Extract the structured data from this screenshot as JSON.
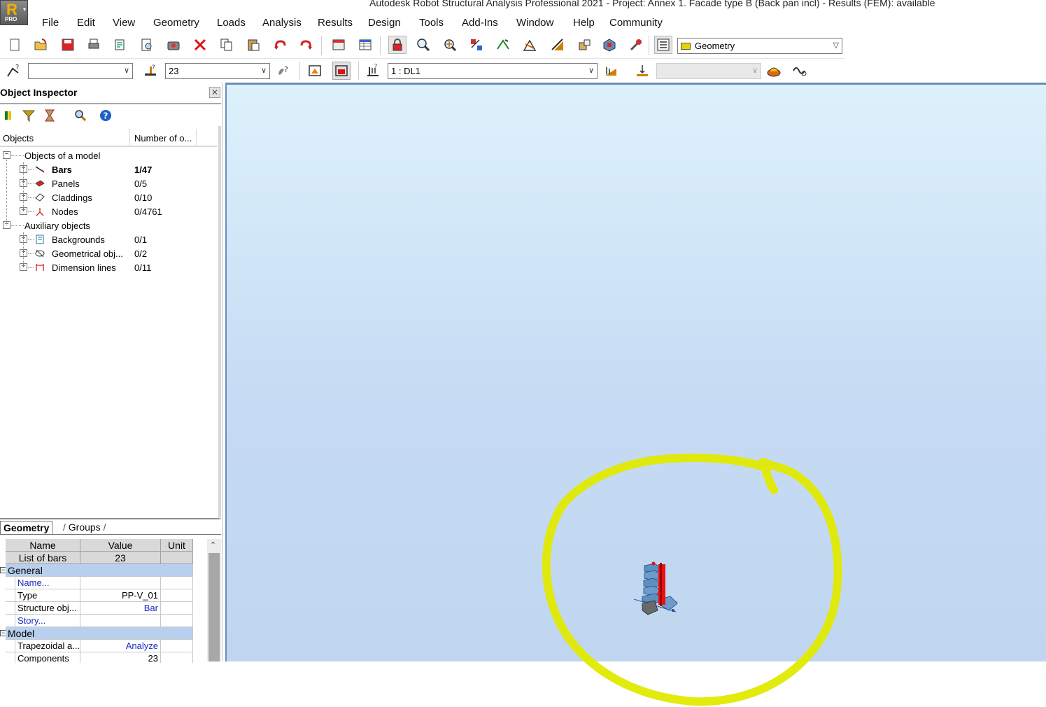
{
  "window": {
    "title": "Autodesk Robot Structural Analysis Professional 2021 - Project: Annex 1. Facade type B (Back pan incl) - Results (FEM): available",
    "logo_letter": "R",
    "logo_badge": "PRO"
  },
  "menu": [
    "File",
    "Edit",
    "View",
    "Geometry",
    "Loads",
    "Analysis",
    "Results",
    "Design",
    "Tools",
    "Add-Ins",
    "Window",
    "Help",
    "Community"
  ],
  "toolbar1": {
    "icons": [
      "new-file-icon",
      "open-file-icon",
      "save-icon",
      "print-icon",
      "print-preview-icon",
      "print-compose-icon",
      "screen-capture-icon",
      "delete-icon",
      "copy-icon",
      "paste-icon",
      "undo-icon",
      "redo-icon",
      "calculator-icon",
      "tables-icon",
      "lock-icon",
      "zoom-icon",
      "zoom-window-icon",
      "display-icon",
      "structure-model-icon",
      "section-icon",
      "materials-icon",
      "job-preferences-icon",
      "structure-view-icon",
      "preferences-icon",
      "layout-selector-icon"
    ],
    "layout_combo": "Geometry"
  },
  "toolbar2": {
    "node_selection": "",
    "bar_selection": "23",
    "load_case": "1 : DL1",
    "disabled_combo": ""
  },
  "inspector": {
    "title": "Object Inspector",
    "columns": [
      "Objects",
      "Number of o..."
    ],
    "tree": [
      {
        "label": "Objects of a model",
        "count": "",
        "level": 0,
        "icon": ""
      },
      {
        "label": "Bars",
        "count": "1/47",
        "level": 1,
        "icon": "bar-icon",
        "bold": true
      },
      {
        "label": "Panels",
        "count": "0/5",
        "level": 1,
        "icon": "panel-icon"
      },
      {
        "label": "Claddings",
        "count": "0/10",
        "level": 1,
        "icon": "cladding-icon"
      },
      {
        "label": "Nodes",
        "count": "0/4761",
        "level": 1,
        "icon": "node-icon"
      },
      {
        "label": "Auxiliary objects",
        "count": "",
        "level": 0,
        "icon": ""
      },
      {
        "label": "Backgrounds",
        "count": "0/1",
        "level": 1,
        "icon": "background-icon"
      },
      {
        "label": "Geometrical obj...",
        "count": "0/2",
        "level": 1,
        "icon": "geometrical-object-icon"
      },
      {
        "label": "Dimension lines",
        "count": "0/11",
        "level": 1,
        "icon": "dimension-line-icon"
      }
    ],
    "tabs": [
      "Geometry",
      "Groups"
    ],
    "props_header": [
      "Name",
      "Value",
      "Unit"
    ],
    "list_of_bars": {
      "name": "List of bars",
      "value": "23"
    },
    "groups": [
      {
        "name": "General",
        "rows": [
          {
            "name": "Name...",
            "value": "",
            "link": true
          },
          {
            "name": "Type",
            "value": "PP-V_01"
          },
          {
            "name": "Structure obj...",
            "value": "Bar",
            "value_link": true
          },
          {
            "name": "Story...",
            "value": "",
            "link": true
          }
        ]
      },
      {
        "name": "Model",
        "rows": [
          {
            "name": "Trapezoidal a...",
            "value": "Analyze",
            "value_link": true
          },
          {
            "name": "Components",
            "value": "23"
          }
        ]
      }
    ]
  },
  "colors": {
    "highlight": "#e0ea00",
    "member_blue": "#5f8fc0",
    "member_red": "#e81010",
    "group_row": "#b9cfee"
  }
}
